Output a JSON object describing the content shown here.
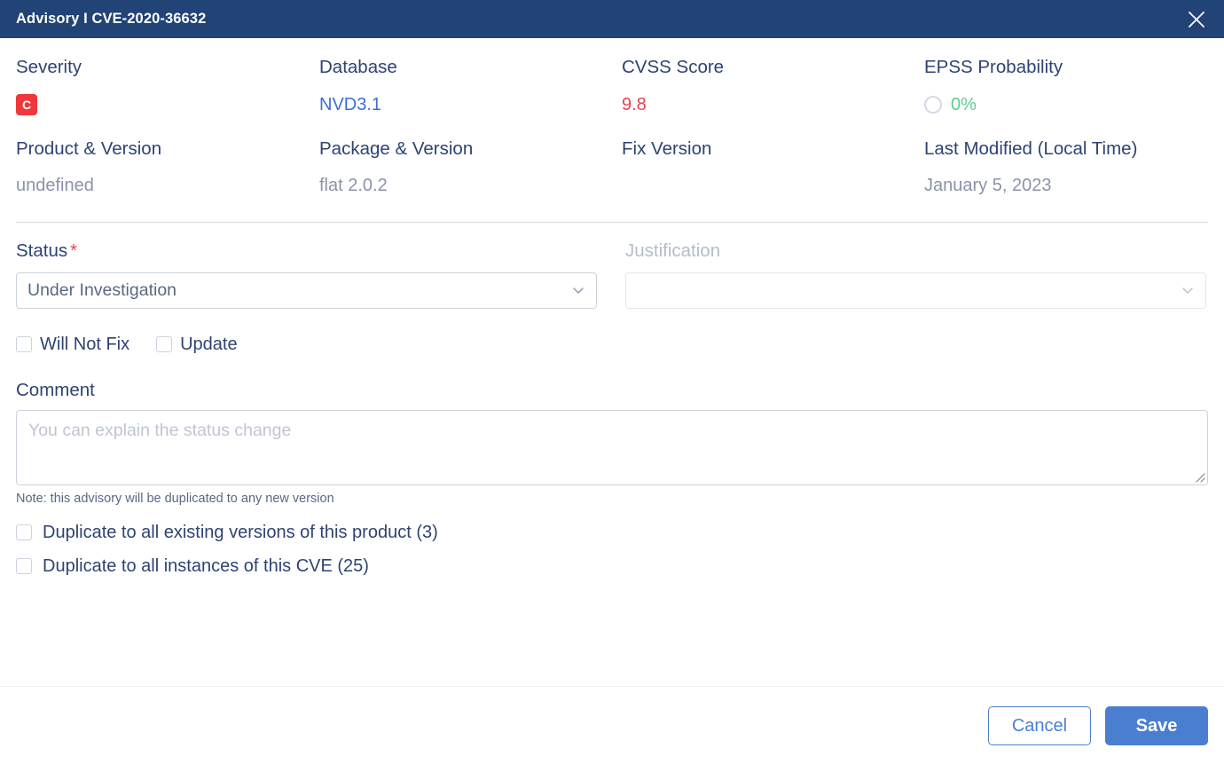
{
  "header": {
    "title": "Advisory I CVE-2020-36632",
    "close_icon": "close-icon"
  },
  "info": {
    "severity": {
      "label": "Severity",
      "badge": "C",
      "badge_color": "#f0373c"
    },
    "database": {
      "label": "Database",
      "value": "NVD3.1",
      "color": "#3b6fd4"
    },
    "cvss": {
      "label": "CVSS Score",
      "value": "9.8",
      "color": "#e8424a"
    },
    "epss": {
      "label": "EPSS Probability",
      "value": "0%",
      "color": "#5fca8e",
      "icon": "progress-ring-icon"
    },
    "product": {
      "label": "Product & Version",
      "value": "undefined"
    },
    "package": {
      "label": "Package & Version",
      "value": "flat 2.0.2"
    },
    "fix": {
      "label": "Fix Version",
      "value": ""
    },
    "modified": {
      "label": "Last Modified (Local Time)",
      "value": "January 5, 2023"
    }
  },
  "form": {
    "status": {
      "label": "Status",
      "required_marker": "*",
      "selected": "Under Investigation"
    },
    "justification": {
      "label": "Justification",
      "selected": ""
    },
    "flags": [
      {
        "label": "Will Not Fix",
        "checked": false
      },
      {
        "label": "Update",
        "checked": false
      }
    ],
    "comment": {
      "label": "Comment",
      "value": "",
      "placeholder": "You can explain the status change",
      "note": "Note: this advisory will be duplicated to any new version"
    },
    "duplicate_options": [
      {
        "label": "Duplicate to all existing versions of this product (3)",
        "checked": false
      },
      {
        "label": "Duplicate to all instances of this CVE (25)",
        "checked": false
      }
    ]
  },
  "footer": {
    "cancel_label": "Cancel",
    "save_label": "Save",
    "accent_color": "#4a7fd0"
  }
}
